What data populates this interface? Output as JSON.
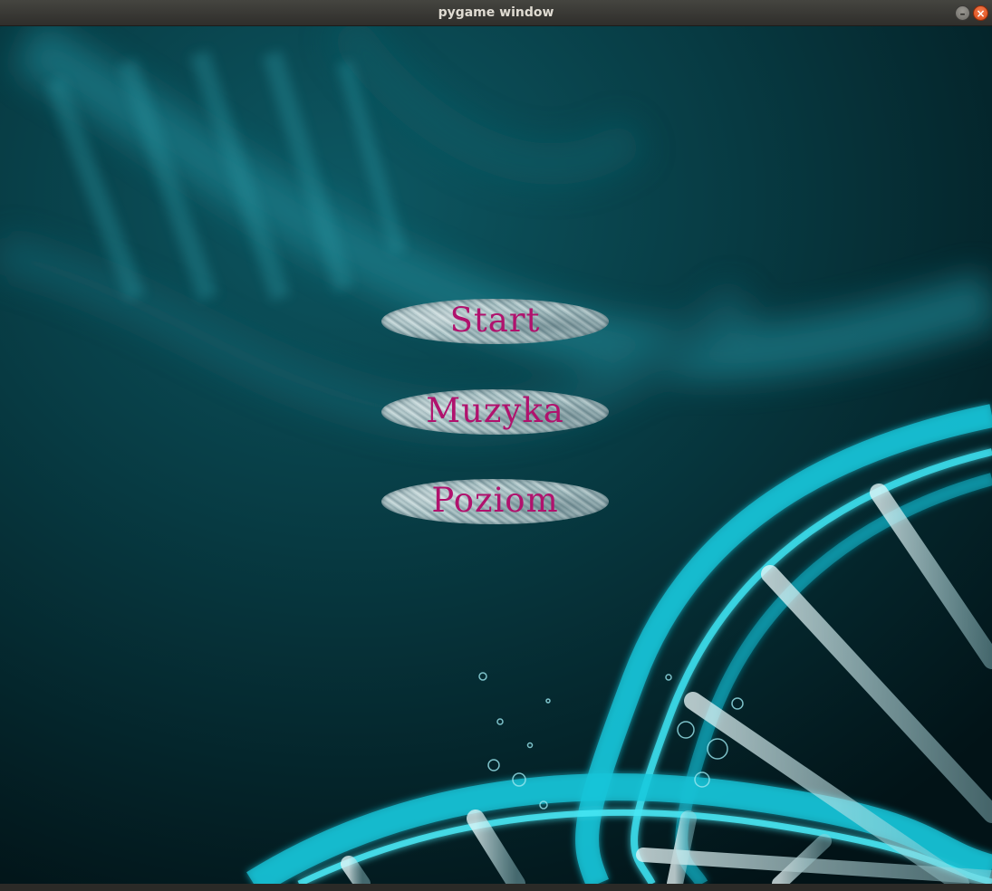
{
  "window": {
    "title": "pygame window",
    "minimize_glyph": "–",
    "close_glyph": "×"
  },
  "menu": {
    "buttons": [
      {
        "label": "Start"
      },
      {
        "label": "Muzyka"
      },
      {
        "label": "Poziom"
      }
    ],
    "label_color": "#b0126d"
  },
  "background": {
    "theme": "teal DNA double helix",
    "colors": {
      "deep": "#031c22",
      "mid": "#0b4d57",
      "glow": "#1fd3e6",
      "rung": "#cfe9ec"
    }
  }
}
